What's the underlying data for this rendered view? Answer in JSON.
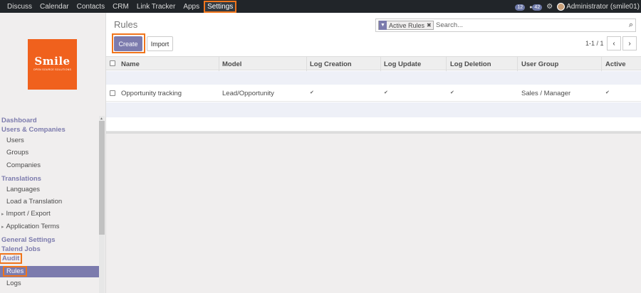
{
  "topbar": {
    "menu": [
      "Discuss",
      "Calendar",
      "Contacts",
      "CRM",
      "Link Tracker",
      "Apps",
      "Settings"
    ],
    "active": "Settings",
    "badge_messages": "12",
    "badge_activity": "42",
    "user": "Administrator (smile01)"
  },
  "logo": {
    "name": "Smile",
    "tagline": "OPEN SOURCE SOLUTIONS"
  },
  "sidebar": {
    "dashboard": "Dashboard",
    "users_companies": "Users & Companies",
    "users": "Users",
    "groups": "Groups",
    "companies": "Companies",
    "translations": "Translations",
    "languages": "Languages",
    "load_translation": "Load a Translation",
    "import_export": "Import / Export",
    "application_terms": "Application Terms",
    "general_settings": "General Settings",
    "talend_jobs": "Talend Jobs",
    "audit": "Audit",
    "rules": "Rules",
    "logs": "Logs"
  },
  "page": {
    "title": "Rules",
    "create_label": "Create",
    "import_label": "Import",
    "pager": "1-1 / 1",
    "search": {
      "facet": "Active Rules",
      "placeholder": "Search..."
    }
  },
  "table": {
    "headers": [
      "Name",
      "Model",
      "Log Creation",
      "Log Update",
      "Log Deletion",
      "User Group",
      "Active"
    ],
    "rows": [
      {
        "name": "Opportunity tracking",
        "model": "Lead/Opportunity",
        "log_creation": true,
        "log_update": true,
        "log_deletion": true,
        "user_group": "Sales / Manager",
        "active": true
      }
    ]
  },
  "colors": {
    "accent": "#7c7bad",
    "highlight": "#f0751c",
    "topbar": "#212529",
    "logo": "#f0611d"
  }
}
